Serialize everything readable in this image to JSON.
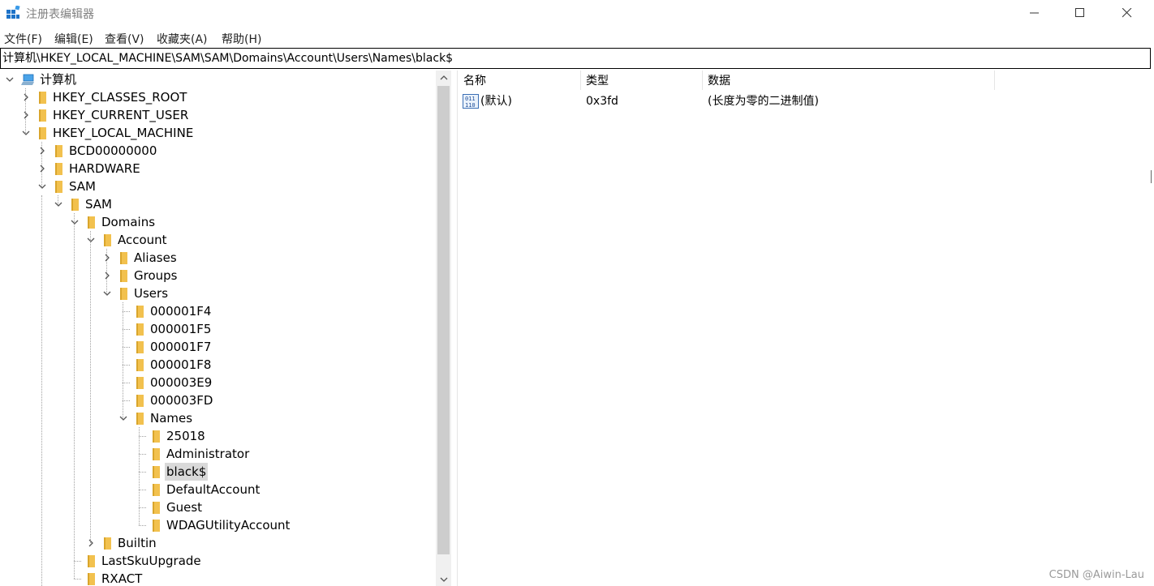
{
  "window": {
    "title": "注册表编辑器",
    "controls": [
      "minimize",
      "maximize",
      "close"
    ]
  },
  "menu": [
    "文件(F)",
    "编辑(E)",
    "查看(V)",
    "收藏夹(A)",
    "帮助(H)"
  ],
  "address": "计算机\\HKEY_LOCAL_MACHINE\\SAM\\SAM\\Domains\\Account\\Users\\Names\\black$",
  "tree": [
    {
      "label": "计算机",
      "level": 0,
      "state": "expanded",
      "kind": "computer"
    },
    {
      "label": "HKEY_CLASSES_ROOT",
      "level": 1,
      "state": "collapsed"
    },
    {
      "label": "HKEY_CURRENT_USER",
      "level": 1,
      "state": "collapsed"
    },
    {
      "label": "HKEY_LOCAL_MACHINE",
      "level": 1,
      "state": "expanded"
    },
    {
      "label": "BCD00000000",
      "level": 2,
      "state": "collapsed"
    },
    {
      "label": "HARDWARE",
      "level": 2,
      "state": "collapsed"
    },
    {
      "label": "SAM",
      "level": 2,
      "state": "expanded"
    },
    {
      "label": "SAM",
      "level": 3,
      "state": "expanded"
    },
    {
      "label": "Domains",
      "level": 4,
      "state": "expanded"
    },
    {
      "label": "Account",
      "level": 5,
      "state": "expanded"
    },
    {
      "label": "Aliases",
      "level": 6,
      "state": "collapsed"
    },
    {
      "label": "Groups",
      "level": 6,
      "state": "collapsed"
    },
    {
      "label": "Users",
      "level": 6,
      "state": "expanded"
    },
    {
      "label": "000001F4",
      "level": 7,
      "state": "leaf"
    },
    {
      "label": "000001F5",
      "level": 7,
      "state": "leaf"
    },
    {
      "label": "000001F7",
      "level": 7,
      "state": "leaf"
    },
    {
      "label": "000001F8",
      "level": 7,
      "state": "leaf"
    },
    {
      "label": "000003E9",
      "level": 7,
      "state": "leaf"
    },
    {
      "label": "000003FD",
      "level": 7,
      "state": "leaf"
    },
    {
      "label": "Names",
      "level": 7,
      "state": "expanded"
    },
    {
      "label": "25018",
      "level": 8,
      "state": "leaf"
    },
    {
      "label": "Administrator",
      "level": 8,
      "state": "leaf"
    },
    {
      "label": "black$",
      "level": 8,
      "state": "leaf",
      "selected": true
    },
    {
      "label": "DefaultAccount",
      "level": 8,
      "state": "leaf"
    },
    {
      "label": "Guest",
      "level": 8,
      "state": "leaf"
    },
    {
      "label": "WDAGUtilityAccount",
      "level": 8,
      "state": "leaf"
    },
    {
      "label": "Builtin",
      "level": 5,
      "state": "collapsed"
    },
    {
      "label": "LastSkuUpgrade",
      "level": 4,
      "state": "leaf"
    },
    {
      "label": "RXACT",
      "level": 4,
      "state": "leaf"
    }
  ],
  "columns": [
    "名称",
    "类型",
    "数据"
  ],
  "values": [
    {
      "name": "(默认)",
      "type": "0x3fd",
      "data": "(长度为零的二进制值)"
    }
  ],
  "watermark": "CSDN @Aiwin-Lau",
  "colors": {
    "folder": "#f2c14e",
    "selection": "#d9d9d9",
    "icon_blue": "#1e73c8"
  }
}
